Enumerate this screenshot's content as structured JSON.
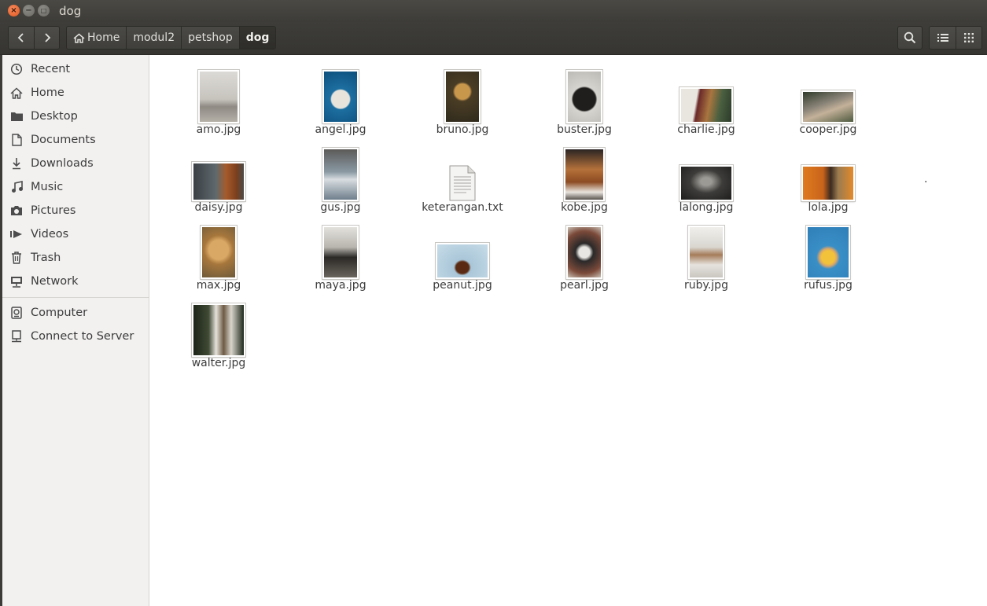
{
  "window": {
    "title": "dog",
    "controls": {
      "close": "×",
      "minimize": "−",
      "maximize": "□"
    }
  },
  "toolbar": {
    "back_icon": "chevron-left-icon",
    "forward_icon": "chevron-right-icon",
    "breadcrumbs": [
      "Home",
      "modul2",
      "petshop",
      "dog"
    ],
    "active_crumb": "dog",
    "search_icon": "search-icon",
    "view_list_icon": "list-view-icon",
    "view_grid_icon": "grid-view-icon"
  },
  "sidebar": {
    "places": [
      {
        "label": "Recent",
        "icon": "clock-icon"
      },
      {
        "label": "Home",
        "icon": "home-icon"
      },
      {
        "label": "Desktop",
        "icon": "folder-icon"
      },
      {
        "label": "Documents",
        "icon": "document-icon"
      },
      {
        "label": "Downloads",
        "icon": "download-icon"
      },
      {
        "label": "Music",
        "icon": "music-icon"
      },
      {
        "label": "Pictures",
        "icon": "camera-icon"
      },
      {
        "label": "Videos",
        "icon": "video-icon"
      },
      {
        "label": "Trash",
        "icon": "trash-icon"
      },
      {
        "label": "Network",
        "icon": "network-icon"
      }
    ],
    "devices": [
      {
        "label": "Computer",
        "icon": "computer-icon"
      },
      {
        "label": "Connect to Server",
        "icon": "server-icon"
      }
    ]
  },
  "files": [
    {
      "name": "amo.jpg",
      "type": "image"
    },
    {
      "name": "angel.jpg",
      "type": "image"
    },
    {
      "name": "bruno.jpg",
      "type": "image"
    },
    {
      "name": "buster.jpg",
      "type": "image"
    },
    {
      "name": "charlie.jpg",
      "type": "image"
    },
    {
      "name": "cooper.jpg",
      "type": "image"
    },
    {
      "name": "daisy.jpg",
      "type": "image"
    },
    {
      "name": "gus.jpg",
      "type": "image"
    },
    {
      "name": "keterangan.txt",
      "type": "text"
    },
    {
      "name": "kobe.jpg",
      "type": "image"
    },
    {
      "name": "lalong.jpg",
      "type": "image"
    },
    {
      "name": "lola.jpg",
      "type": "image"
    },
    {
      "name": "max.jpg",
      "type": "image"
    },
    {
      "name": "maya.jpg",
      "type": "image"
    },
    {
      "name": "peanut.jpg",
      "type": "image"
    },
    {
      "name": "pearl.jpg",
      "type": "image"
    },
    {
      "name": "ruby.jpg",
      "type": "image"
    },
    {
      "name": "rufus.jpg",
      "type": "image"
    },
    {
      "name": "walter.jpg",
      "type": "image"
    }
  ],
  "stray_text": "."
}
